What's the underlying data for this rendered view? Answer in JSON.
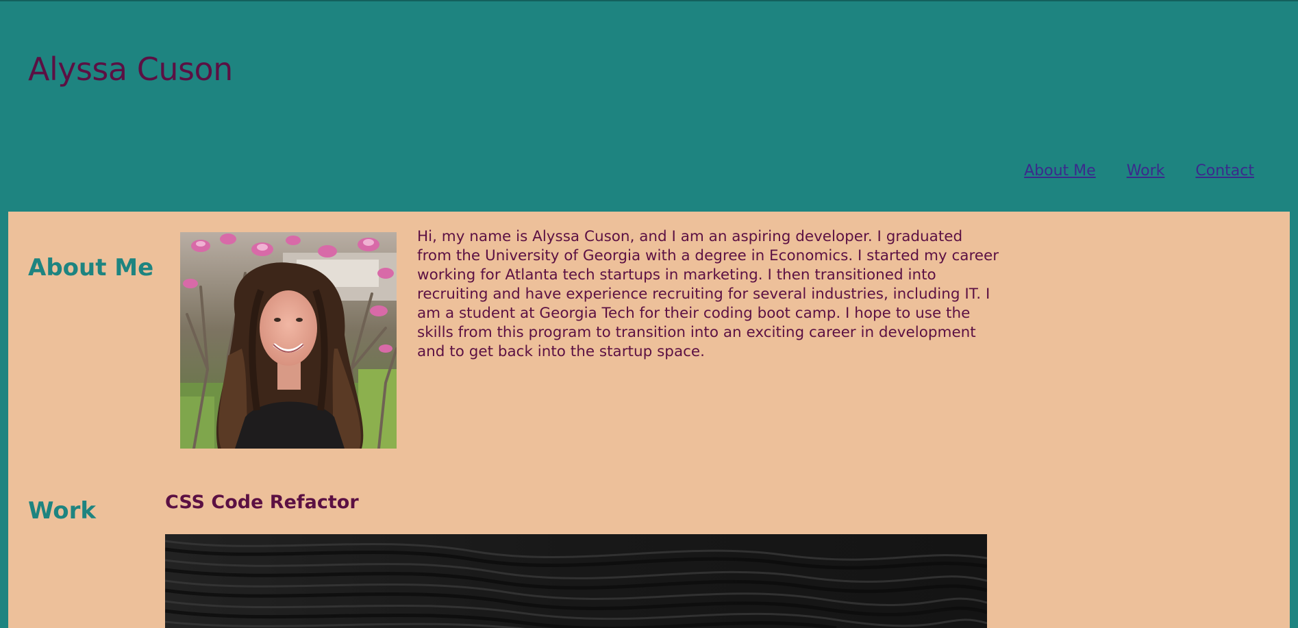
{
  "header": {
    "title": "Alyssa Cuson",
    "nav": [
      {
        "label": "About Me"
      },
      {
        "label": "Work"
      },
      {
        "label": "Contact"
      }
    ]
  },
  "about": {
    "heading": "About Me",
    "paragraph": "Hi, my name is Alyssa Cuson, and I am an aspiring developer. I graduated from the University of Georgia with a degree in Economics. I started my career working for Atlanta tech startups in marketing. I then transitioned into recruiting and have experience recruiting for several industries, including IT. I am a student at Georgia Tech for their coding boot camp. I hope to use the skills from this program to transition into an exciting career in development and to get back into the startup space."
  },
  "work": {
    "heading": "Work",
    "projects": [
      {
        "title": "CSS Code Refactor"
      }
    ]
  },
  "colors": {
    "header_background": "#1e8480",
    "content_background": "#edc09a",
    "title_color": "#5b1043",
    "section_heading_color": "#1e8480",
    "nav_link_color": "#3b2a8c"
  }
}
